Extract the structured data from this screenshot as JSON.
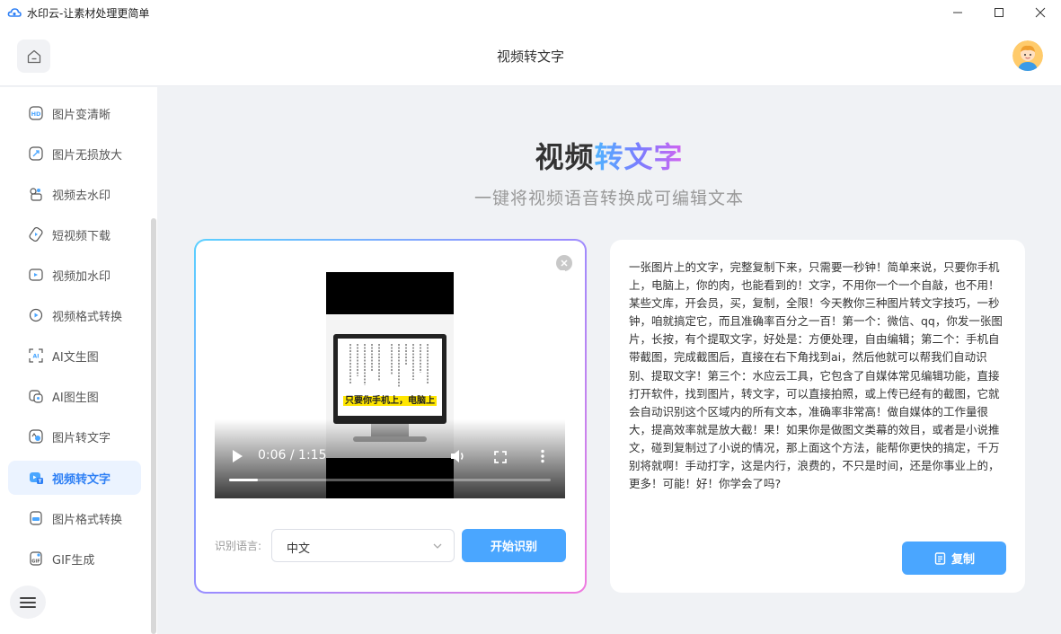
{
  "app": {
    "title": "水印云-让素材处理更简单"
  },
  "header": {
    "page_title": "视频转文字"
  },
  "sidebar": {
    "items": [
      {
        "label": "图片变清晰",
        "icon": "hd-icon",
        "active": false
      },
      {
        "label": "图片无损放大",
        "icon": "enlarge-icon",
        "active": false
      },
      {
        "label": "视频去水印",
        "icon": "video-watermark-remove-icon",
        "active": false
      },
      {
        "label": "短视频下载",
        "icon": "video-download-icon",
        "active": false
      },
      {
        "label": "视频加水印",
        "icon": "video-add-watermark-icon",
        "active": false
      },
      {
        "label": "视频格式转换",
        "icon": "video-format-icon",
        "active": false
      },
      {
        "label": "AI文生图",
        "icon": "ai-text-image-icon",
        "active": false
      },
      {
        "label": "AI图生图",
        "icon": "ai-image-image-icon",
        "active": false
      },
      {
        "label": "图片转文字",
        "icon": "image-to-text-icon",
        "active": false
      },
      {
        "label": "视频转文字",
        "icon": "video-to-text-icon",
        "active": true
      },
      {
        "label": "图片格式转换",
        "icon": "image-format-icon",
        "active": false
      },
      {
        "label": "GIF生成",
        "icon": "gif-icon",
        "active": false
      }
    ]
  },
  "hero": {
    "title_part1": "视频",
    "title_part2": "转文字",
    "subtitle": "一键将视频语音转换成可编辑文本"
  },
  "video": {
    "subtitle_text": "只要你手机上，电脑上",
    "time": "0:06 / 1:15",
    "progress": 0.09
  },
  "controls": {
    "lang_label": "识别语言:",
    "lang_value": "中文",
    "start_label": "开始识别"
  },
  "result": {
    "text": "一张图片上的文字，完整复制下来，只需要一秒钟！简单来说，只要你手机上，电脑上，你的肉，也能看到的！文字，不用你一个一个自敲，也不用！某些文库，开会员，买，复制，全限！今天教你三种图片转文字技巧，一秒钟，咱就搞定它，而且准确率百分之一百！第一个：微信、qq，你发一张图片，长按，有个提取文字，好处是：方便处理，自由编辑；第二个：手机自带截图，完成截图后，直接在右下角找到ai，然后他就可以帮我们自动识别、提取文字！第三个：水应云工具，它包含了自媒体常见编辑功能，直接打开软件，找到图片，转文字，可以直接拍照，或上传已经有的截图，它就会自动识别这个区域内的所有文本，准确率非常高！做自媒体的工作量很大，提高效率就是放大截！果！如果你是做图文类幕的效目，或者是小说推文，碰到复制过了小说的情况，那上面这个方法，能帮你更快的搞定，千万别将就啊！手动打字，这是内行，浪费的，不只是时间，还是你事业上的，更多！可能！好！你学会了吗?",
    "copy_label": "复制"
  },
  "colors": {
    "accent": "#4aa6ff",
    "active_text": "#2f80f5",
    "active_bg": "#ebf3ff"
  }
}
